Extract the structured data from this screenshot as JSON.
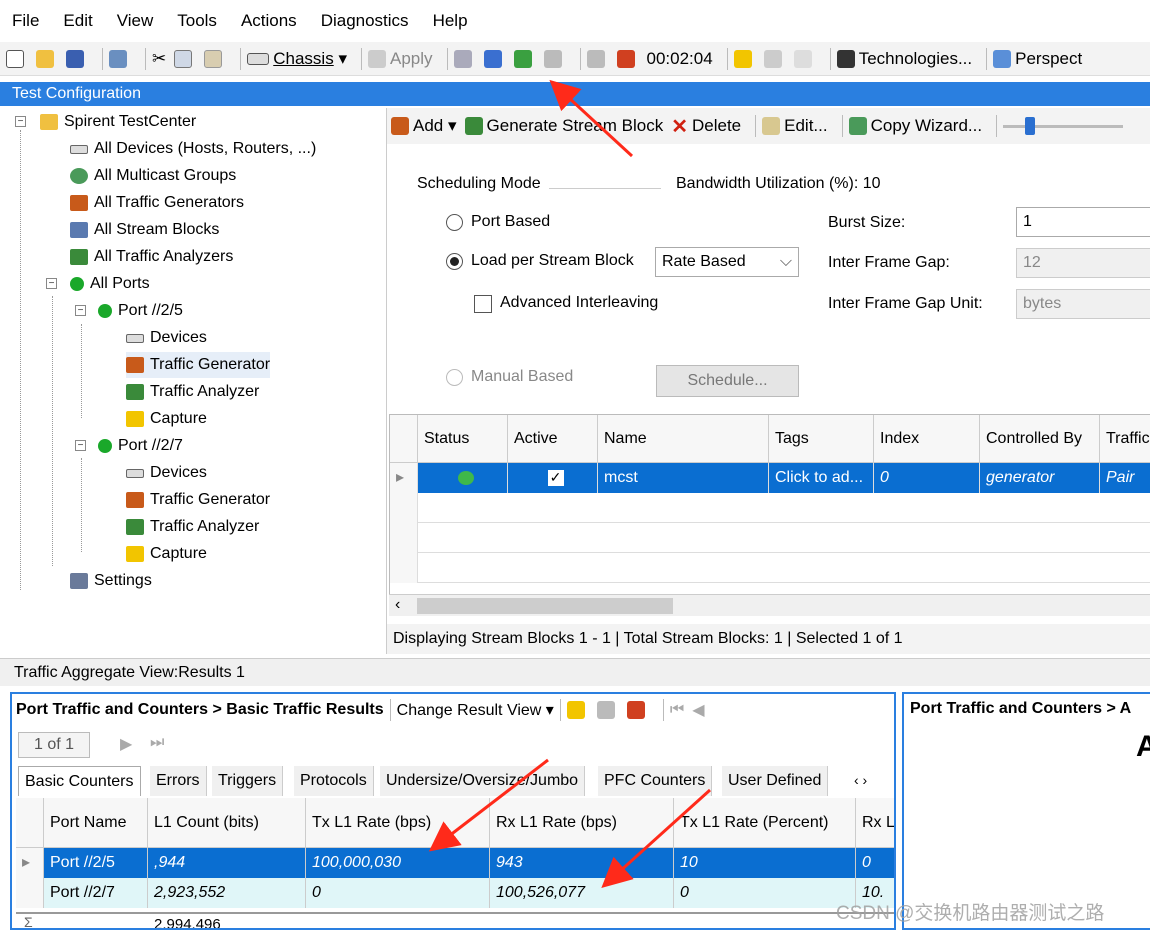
{
  "menu": [
    "File",
    "Edit",
    "View",
    "Tools",
    "Actions",
    "Diagnostics",
    "Help"
  ],
  "toolbar": {
    "chassis": "Chassis",
    "apply": "Apply",
    "timer": "00:02:04",
    "technologies": "Technologies...",
    "perspective": "Perspect"
  },
  "test_config_title": "Test Configuration",
  "tree": {
    "root": "Spirent TestCenter",
    "all_devices": "All Devices (Hosts, Routers, ...)",
    "all_multicast": "All Multicast Groups",
    "all_traffic_generators": "All Traffic Generators",
    "all_stream_blocks": "All Stream Blocks",
    "all_traffic_analyzers": "All Traffic Analyzers",
    "all_ports": "All Ports",
    "port1": "Port //2/5",
    "port2": "Port //2/7",
    "devices": "Devices",
    "traffic_generator": "Traffic Generator",
    "traffic_analyzer": "Traffic Analyzer",
    "capture": "Capture",
    "settings": "Settings"
  },
  "right_toolbar": {
    "add": "Add",
    "generate": "Generate Stream Block",
    "delete": "Delete",
    "edit": "Edit...",
    "copy_wizard": "Copy Wizard..."
  },
  "scheduling": {
    "mode_label": "Scheduling Mode",
    "bandwidth": "Bandwidth Utilization (%): 10",
    "port_based": "Port Based",
    "load_per_stream": "Load per Stream Block",
    "rate_select": "Rate Based",
    "advanced": "Advanced Interleaving",
    "manual": "Manual Based",
    "schedule_btn": "Schedule...",
    "burst_label": "Burst Size:",
    "burst_value": "1",
    "ifg_label": "Inter Frame Gap:",
    "ifg_value": "12",
    "ifg_unit_label": "Inter Frame Gap Unit:",
    "ifg_unit_value": "bytes"
  },
  "stream_grid": {
    "headers": [
      "Status",
      "Active",
      "Name",
      "Tags",
      "Index",
      "Controlled By",
      "Traffic"
    ],
    "row": {
      "name": "mcst",
      "tags": "Click to ad...",
      "index": "0",
      "controlled": "generator",
      "traffic": "Pair"
    }
  },
  "stream_status": "Displaying Stream Blocks 1 - 1  |  Total Stream Blocks: 1  |  Selected 1 of 1",
  "aggregate_title": "Traffic Aggregate View:Results 1",
  "results": {
    "title": "Port Traffic and Counters > Basic Traffic Results",
    "change_view": "Change Result View",
    "pager": "1 of 1",
    "tabs": [
      "Basic Counters",
      "Errors",
      "Triggers",
      "Protocols",
      "Undersize/Oversize/Jumbo",
      "PFC Counters",
      "User Defined"
    ],
    "headers": [
      "Port Name",
      "L1 Count (bits)",
      "Tx L1 Rate (bps)",
      "Rx L1 Rate (bps)",
      "Tx L1 Rate (Percent)",
      "Rx L"
    ],
    "rows": [
      [
        "Port //2/5",
        ",944",
        "100,000,030",
        "943",
        "10",
        "0"
      ],
      [
        "Port //2/7",
        "2,923,552",
        "0",
        "100,526,077",
        "0",
        "10."
      ]
    ],
    "total_partial": "2,994,496"
  },
  "right_results_title": "Port Traffic and Counters > A",
  "right_results_letter": "A",
  "watermark": "CSDN @交换机路由器测试之路",
  "colors": {
    "accent": "#2a7fe0",
    "selected": "#0a6ed1",
    "alt_row": "#e0f6f8",
    "arrow": "#ff2a1a"
  }
}
